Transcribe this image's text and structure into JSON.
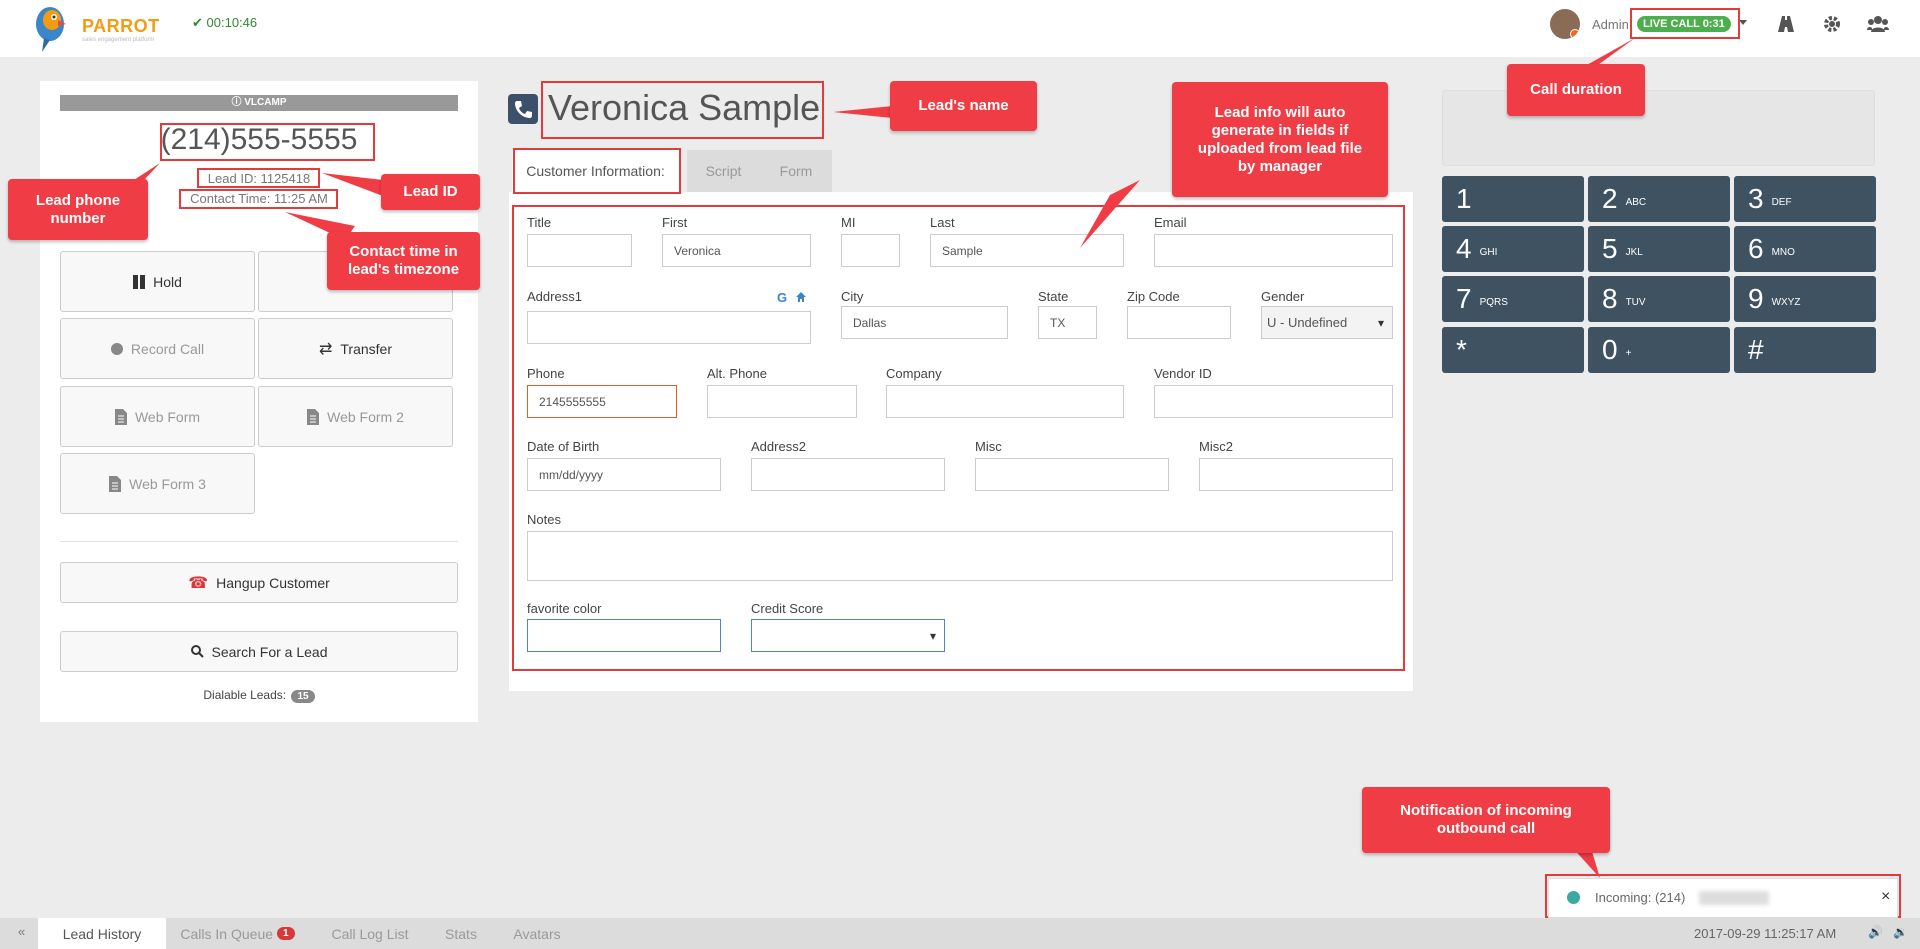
{
  "header": {
    "logo_text": "PARROT",
    "logo_subtext": "sales engagement platform",
    "timer": "00:10:46",
    "user_name": "Admin",
    "live_call": "LIVE CALL 0:31",
    "icons": [
      "road-icon",
      "gear-icon",
      "users-icon"
    ]
  },
  "left_panel": {
    "campaign": "VLCAMP",
    "phone": "(214)555-5555",
    "lead_id": "Lead ID: 1125418",
    "contact_time": "Contact Time: 11:25 AM",
    "buttons": {
      "hold": "Hold",
      "record": "Record Call",
      "transfer": "Transfer",
      "web_form": "Web Form",
      "web_form_2": "Web Form 2",
      "web_form_3": "Web Form 3",
      "hangup": "Hangup Customer",
      "search": "Search For a Lead"
    },
    "dialable_label": "Dialable Leads:",
    "dialable_count": "15"
  },
  "lead": {
    "name": "Veronica Sample"
  },
  "tabs": [
    "Customer Information:",
    "Script",
    "Form"
  ],
  "form": {
    "title": {
      "label": "Title",
      "value": ""
    },
    "first": {
      "label": "First",
      "value": "Veronica"
    },
    "mi": {
      "label": "MI",
      "value": ""
    },
    "last": {
      "label": "Last",
      "value": "Sample"
    },
    "email": {
      "label": "Email",
      "value": ""
    },
    "address1": {
      "label": "Address1",
      "value": ""
    },
    "city": {
      "label": "City",
      "value": "Dallas"
    },
    "state": {
      "label": "State",
      "value": "TX"
    },
    "zip": {
      "label": "Zip Code",
      "value": ""
    },
    "gender": {
      "label": "Gender",
      "value": "U - Undefined"
    },
    "phone": {
      "label": "Phone",
      "value": "2145555555"
    },
    "alt_phone": {
      "label": "Alt. Phone",
      "value": ""
    },
    "company": {
      "label": "Company",
      "value": ""
    },
    "vendor_id": {
      "label": "Vendor ID",
      "value": ""
    },
    "dob": {
      "label": "Date of Birth",
      "placeholder": "mm/dd/yyyy"
    },
    "address2": {
      "label": "Address2",
      "value": ""
    },
    "misc": {
      "label": "Misc",
      "value": ""
    },
    "misc2": {
      "label": "Misc2",
      "value": ""
    },
    "notes": {
      "label": "Notes",
      "value": ""
    },
    "favorite_color": {
      "label": "favorite color",
      "value": ""
    },
    "credit_score": {
      "label": "Credit Score",
      "value": ""
    }
  },
  "dialpad": [
    {
      "n": "1",
      "l": ""
    },
    {
      "n": "2",
      "l": "ABC"
    },
    {
      "n": "3",
      "l": "DEF"
    },
    {
      "n": "4",
      "l": "GHI"
    },
    {
      "n": "5",
      "l": "JKL"
    },
    {
      "n": "6",
      "l": "MNO"
    },
    {
      "n": "7",
      "l": "PQRS"
    },
    {
      "n": "8",
      "l": "TUV"
    },
    {
      "n": "9",
      "l": "WXYZ"
    },
    {
      "n": "*",
      "l": ""
    },
    {
      "n": "0",
      "l": "+"
    },
    {
      "n": "#",
      "l": ""
    }
  ],
  "callouts": {
    "lead_name": "Lead's name",
    "auto_fill": "Lead info will auto generate in fields if uploaded from lead file by manager",
    "call_duration": "Call duration",
    "lead_phone": "Lead phone number",
    "lead_id": "Lead ID",
    "contact_time": "Contact time in lead's timezone",
    "notification": "Notification of incoming outbound call"
  },
  "notification": {
    "text": "Incoming: (214)",
    "close": "×"
  },
  "bottom_tabs": [
    "Lead History",
    "Calls In Queue",
    "Call Log List",
    "Stats",
    "Avatars"
  ],
  "calls_in_queue_count": "1",
  "datetime": "2017-09-29 11:25:17 AM",
  "colors": {
    "accent": "#3e5261",
    "callout": "#f03c44",
    "live": "#4cae4c",
    "brand": "#f39c12"
  }
}
